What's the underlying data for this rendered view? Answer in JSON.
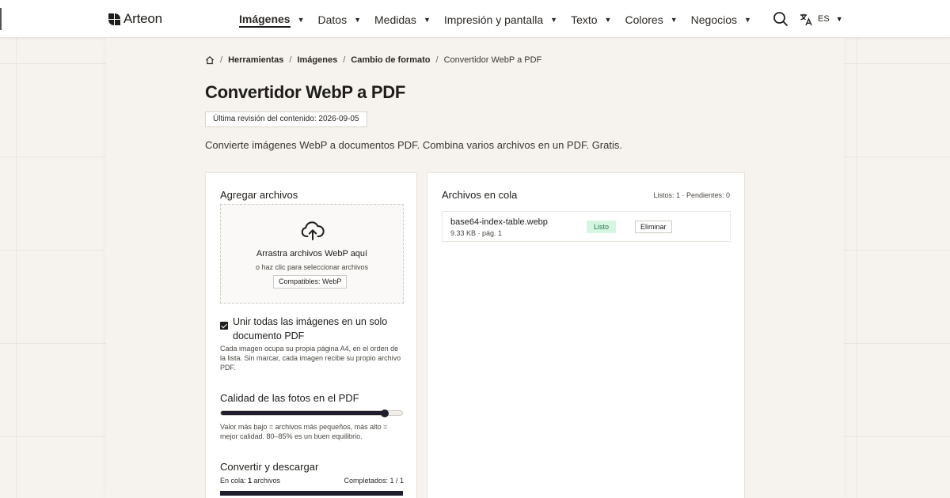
{
  "header": {
    "brand": "Arteon",
    "nav": [
      {
        "label": "Imágenes",
        "active": true
      },
      {
        "label": "Datos",
        "active": false
      },
      {
        "label": "Medidas",
        "active": false
      },
      {
        "label": "Impresión y pantalla",
        "active": false
      },
      {
        "label": "Texto",
        "active": false
      },
      {
        "label": "Colores",
        "active": false
      },
      {
        "label": "Negocios",
        "active": false
      }
    ],
    "language": "ES",
    "icons": {
      "search": "search-icon",
      "translate": "translate-icon",
      "logo": "logo-icon",
      "home": "home-icon"
    }
  },
  "breadcrumb": {
    "items": [
      "Herramientas",
      "Imágenes",
      "Cambio de formato"
    ],
    "current": "Convertidor WebP a PDF",
    "separator": "/"
  },
  "page": {
    "title": "Convertidor WebP a PDF",
    "revision": "Última revisión del contenido: 2026-09-05",
    "intro": "Convierte imágenes WebP a documentos PDF. Combina varios archivos en un PDF. Gratis."
  },
  "upload": {
    "title": "Agregar archivos",
    "drop_main": "Arrastra archivos WebP aquí",
    "drop_sub": "o haz clic para seleccionar archivos",
    "badge": "Compatibles: WebP",
    "merge_label": "Unir todas las imágenes en un solo documento PDF",
    "merge_checked": true,
    "merge_help": "Cada imagen ocupa su propia página A4, en el orden de la lista. Sin marcar, cada imagen recibe su propio archivo PDF.",
    "quality_title": "Calidad de las fotos en el PDF",
    "quality_value": 0.9,
    "quality_help": "Valor más bajo = archivos más pequeños, más alto = mejor calidad. 80–85% es un buen equilibrio.",
    "convert_title": "Convertir y descargar",
    "queue_prefix": "En cola: ",
    "queue_count": "1",
    "queue_suffix": " archivos",
    "completed": "Completados: 1 / 1",
    "progress": 1.0
  },
  "queue": {
    "title": "Archivos en cola",
    "stats": "Listos: 1 · Pendientes: 0",
    "files": [
      {
        "name": "base64-index-table.webp",
        "meta": "9.33 KB · pág. 1",
        "status": "Listo",
        "remove_label": "Eliminar"
      }
    ]
  },
  "colors": {
    "accent": "#1f1d2b",
    "status_bg": "#d7f5e3",
    "status_text": "#1d7a47"
  }
}
